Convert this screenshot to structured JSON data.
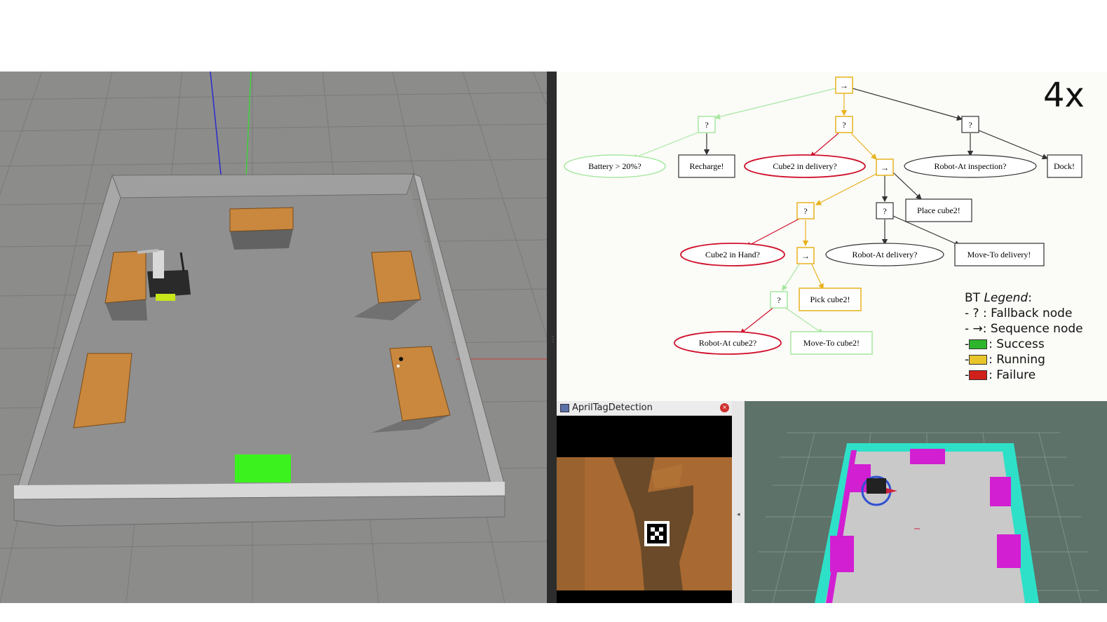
{
  "speed_label": "4x",
  "bt_nodes": {
    "root_seq": "→",
    "fallback_battery": "?",
    "fallback_delivery": "?",
    "fallback_dock": "?",
    "battery_cond": "Battery > 20%?",
    "recharge_action": "Recharge!",
    "cube2_delivery_cond": "Cube2 in delivery?",
    "seq_place": "→",
    "robot_inspection_cond": "Robot-At inspection?",
    "dock_action": "Dock!",
    "fallback_hand": "?",
    "fallback_robot_delivery": "?",
    "place_action": "Place cube2!",
    "cube2_hand_cond": "Cube2 in Hand?",
    "seq_pick": "→",
    "robot_delivery_cond": "Robot-At delivery?",
    "move_delivery_action": "Move-To delivery!",
    "fallback_cube": "?",
    "pick_action": "Pick cube2!",
    "robot_cube_cond": "Robot-At cube2?",
    "move_cube_action": "Move-To cube2!"
  },
  "legend": {
    "title_prefix": "BT ",
    "title_em": "Legend",
    "title_suffix": ":",
    "fallback": "- ? : Fallback node",
    "sequence_dash": "- ",
    "sequence_text": ": Sequence node",
    "success": ": Success",
    "running": ": Running",
    "failure": ": Failure",
    "dash": "-"
  },
  "colors": {
    "success": "#2db52d",
    "running": "#e8b21e",
    "failure": "#d0112b",
    "idle": "#333333",
    "success_line": "#a7e8a0"
  },
  "april_window": {
    "title": "AprilTagDetection",
    "close_icon": "close-icon"
  }
}
